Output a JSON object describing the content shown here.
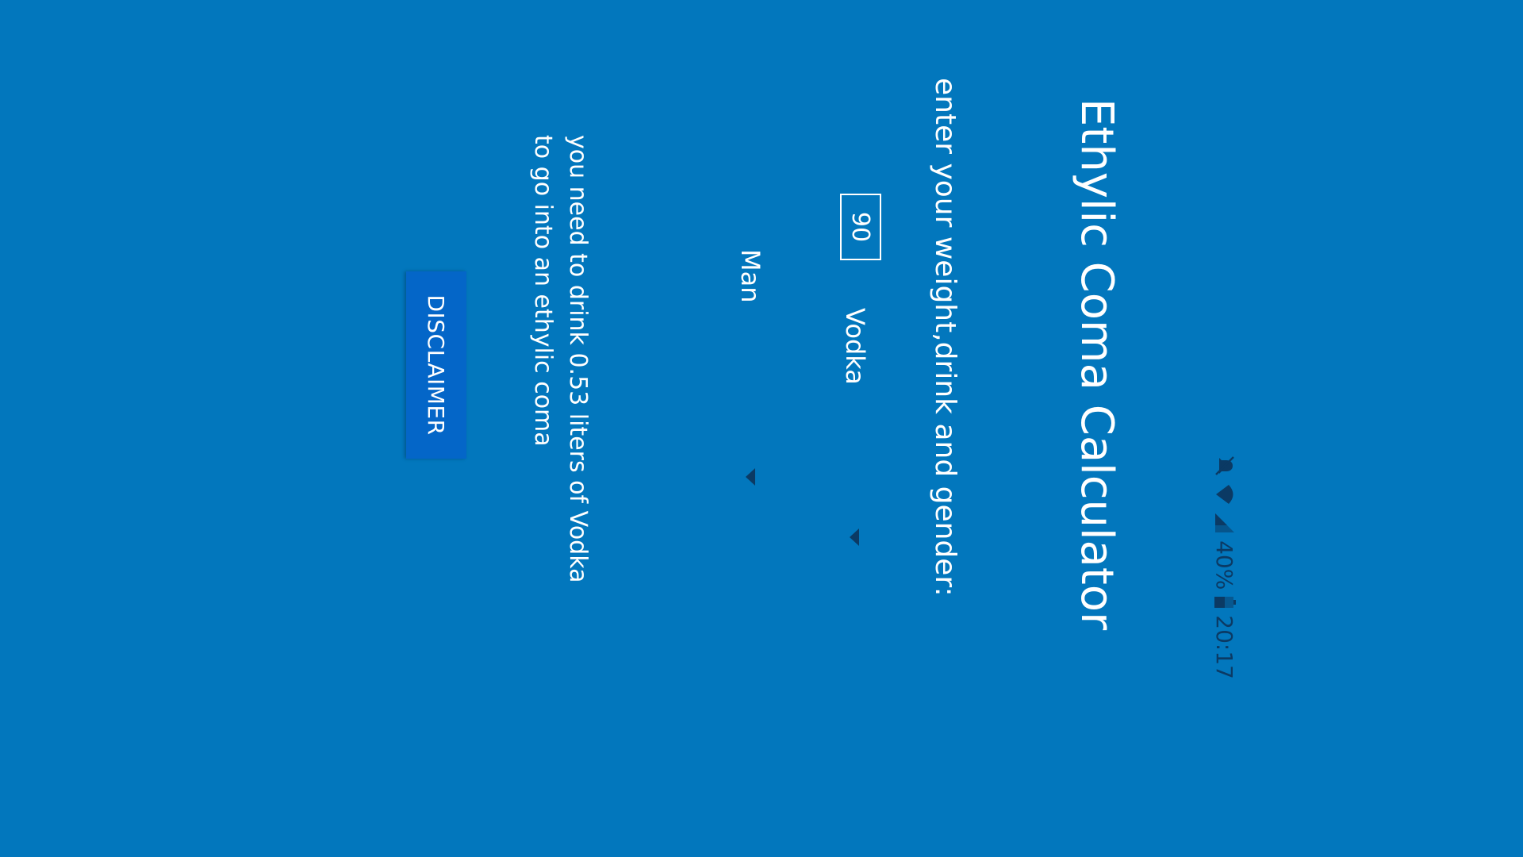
{
  "status_bar": {
    "time": "20:17",
    "battery": "40%",
    "icons": [
      "mute-icon",
      "wifi-icon",
      "signal-icon",
      "battery-icon"
    ]
  },
  "app": {
    "title": "Ethylic Coma Calculator",
    "instruction": "enter your weight,drink and gender:",
    "weight_value": "90",
    "drink_selected": "Vodka",
    "gender_selected": "Man",
    "result_line1": "you need to drink 0.53 liters of Vodka",
    "result_line2": "to go into an ethylic coma",
    "disclaimer_label": "DISCLAIMER"
  },
  "colors": {
    "background": "#0277BD",
    "button": "#0466C8",
    "status_icons": "#0b3a64",
    "text": "#ffffff"
  }
}
